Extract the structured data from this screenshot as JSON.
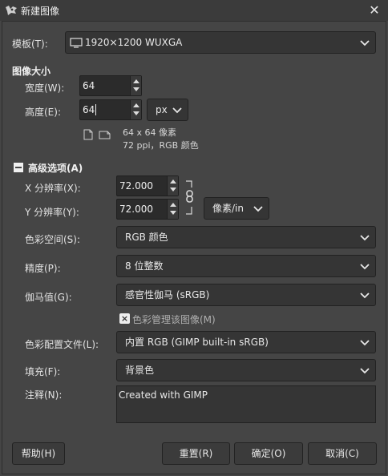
{
  "window": {
    "title": "新建图像"
  },
  "template": {
    "label": "模板(T):",
    "value": "1920×1200 WUXGA"
  },
  "image_size": {
    "section_label": "图像大小",
    "width_label": "宽度(W):",
    "width_value": "64",
    "height_label": "高度(E):",
    "height_value": "64",
    "unit": "px",
    "info_line1": "64 x 64 像素",
    "info_line2": "72 ppi，RGB 颜色"
  },
  "advanced": {
    "section_label": "高级选项(A)",
    "xres_label": "X 分辨率(X):",
    "xres_value": "72.000",
    "yres_label": "Y 分辨率(Y):",
    "yres_value": "72.000",
    "res_unit": "像素/in",
    "colorspace_label": "色彩空间(S):",
    "colorspace_value": "RGB 颜色",
    "precision_label": "精度(P):",
    "precision_value": "8 位整数",
    "gamma_label": "伽马值(G):",
    "gamma_value": "感官性伽马 (sRGB)",
    "color_manage_label": "色彩管理该图像(M)",
    "color_manage_checked": "×",
    "profile_label": "色彩配置文件(L):",
    "profile_value": "内置 RGB (GIMP built-in sRGB)",
    "fill_label": "填充(F):",
    "fill_value": "背景色",
    "comment_label": "注释(N):",
    "comment_value": "Created with GIMP"
  },
  "buttons": {
    "help": "帮助(H)",
    "reset": "重置(R)",
    "ok": "确定(O)",
    "cancel": "取消(C)"
  },
  "icons": {
    "app": "gimp-wilber-icon",
    "monitor": "monitor-icon",
    "portrait": "portrait-icon",
    "landscape": "landscape-icon",
    "chain": "chain-link-icon",
    "collapse": "collapse-minus-icon",
    "chevron": "chevron-down-icon",
    "close": "close-icon"
  },
  "colors": {
    "background": "#454545",
    "field": "#353535",
    "titlebar": "#3b3b3b"
  }
}
